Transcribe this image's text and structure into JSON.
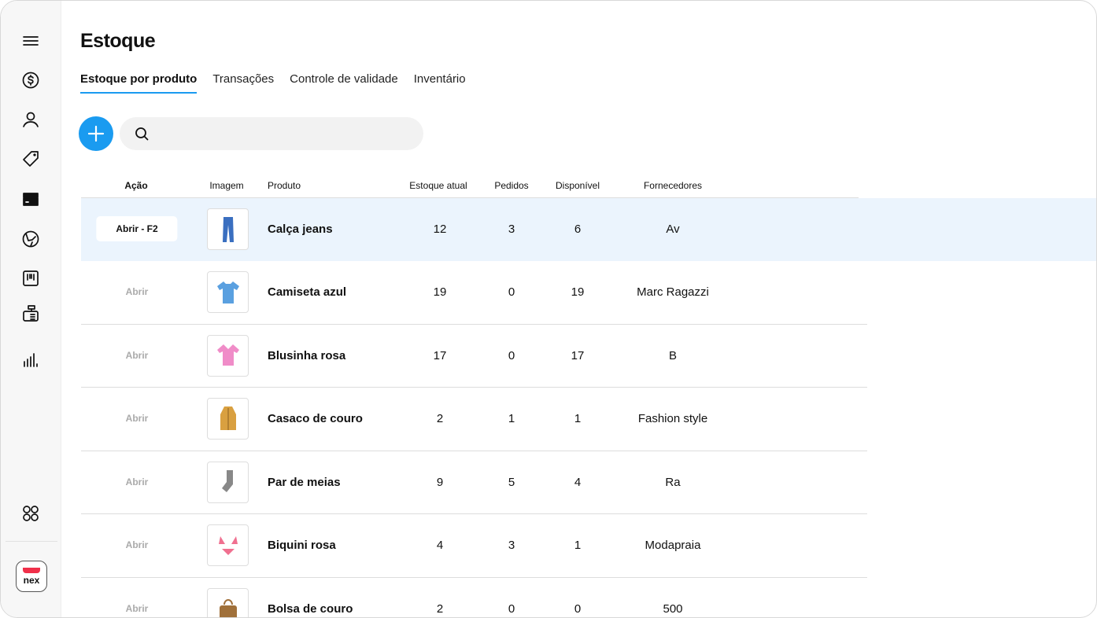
{
  "page_title": "Estoque",
  "tabs": [
    {
      "label": "Estoque por produto"
    },
    {
      "label": "Transações"
    },
    {
      "label": "Controle de validade"
    },
    {
      "label": "Inventário"
    }
  ],
  "search": {
    "placeholder": ""
  },
  "columns": {
    "acao": "Ação",
    "imagem": "Imagem",
    "produto": "Produto",
    "estoque": "Estoque atual",
    "pedidos": "Pedidos",
    "disponivel": "Disponível",
    "fornecedores": "Fornecedores"
  },
  "rows": [
    {
      "action": "Abrir - F2",
      "product": "Calça jeans",
      "stock": "12",
      "orders": "3",
      "available": "6",
      "supplier": "Av",
      "image": "jeans",
      "color": "#3a6fc0"
    },
    {
      "action": "Abrir",
      "product": "Camiseta azul",
      "stock": "19",
      "orders": "0",
      "available": "19",
      "supplier": "Marc Ragazzi",
      "image": "shirt",
      "color": "#5aa0e0"
    },
    {
      "action": "Abrir",
      "product": "Blusinha rosa",
      "stock": "17",
      "orders": "0",
      "available": "17",
      "supplier": "B",
      "image": "blouse",
      "color": "#f08cc8"
    },
    {
      "action": "Abrir",
      "product": "Casaco de couro",
      "stock": "2",
      "orders": "1",
      "available": "1",
      "supplier": "Fashion style",
      "image": "coat",
      "color": "#d9a040"
    },
    {
      "action": "Abrir",
      "product": "Par de meias",
      "stock": "9",
      "orders": "5",
      "available": "4",
      "supplier": "Ra",
      "image": "socks",
      "color": "#888888"
    },
    {
      "action": "Abrir",
      "product": "Biquini rosa",
      "stock": "4",
      "orders": "3",
      "available": "1",
      "supplier": "Modapraia",
      "image": "bikini",
      "color": "#f07090"
    },
    {
      "action": "Abrir",
      "product": "Bolsa de couro",
      "stock": "2",
      "orders": "0",
      "available": "0",
      "supplier": "500",
      "image": "bag",
      "color": "#a0703a"
    }
  ],
  "logo": "nex",
  "accent": "#1a9bf0"
}
